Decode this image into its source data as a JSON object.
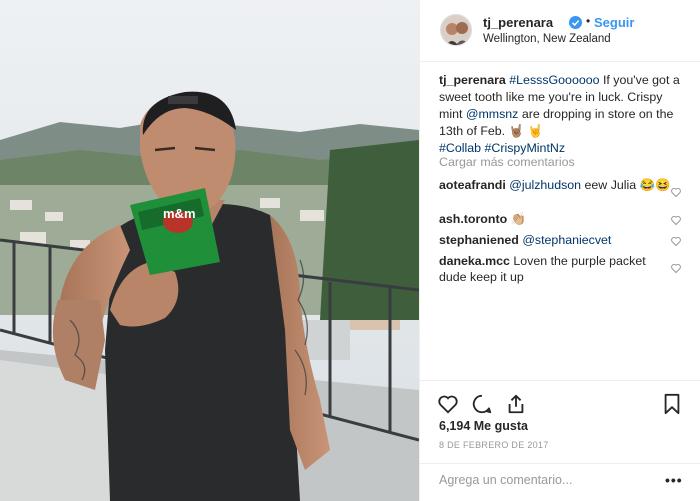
{
  "header": {
    "username": "tj_perenara",
    "separator": "•",
    "follow_label": "Seguir",
    "location": "Wellington, New Zealand"
  },
  "photo": {
    "bag_text": "m&m"
  },
  "caption": {
    "username": "tj_perenara",
    "hashtag_1": "#LesssGoooooo",
    "text_1": " If you've got a sweet tooth like me you're in luck. Crispy mint ",
    "mention": "@mmsnz",
    "text_2": " are dropping in store on the 13th of Feb. 🤘🏽 🤘",
    "hashtag_2": "#Collab",
    "hashtag_3": "#CrispyMintNz"
  },
  "load_more": "Cargar más comentarios",
  "comments": [
    {
      "username": "aoteafrandi",
      "mention": "@julzhudson",
      "text": " eew Julia 😂😆"
    },
    {
      "username": "ash.toronto",
      "mention": "",
      "text": " 👏🏼"
    },
    {
      "username": "stephaniened",
      "mention": "@stephaniecvet",
      "text": ""
    },
    {
      "username": "daneka.mcc",
      "mention": "",
      "text": " Loven the purple packet dude keep it up"
    }
  ],
  "likes": "6,194 Me gusta",
  "date": "8 DE FEBRERO DE 2017",
  "add_comment": {
    "placeholder": "Agrega un comentario...",
    "more_label": "•••"
  },
  "colors": {
    "accent": "#3897f0",
    "link": "#003569",
    "muted": "#999999",
    "text": "#262626",
    "bag_green": "#1f8f3a"
  },
  "icons": [
    "verified-badge-icon",
    "heart-icon",
    "comment-icon",
    "share-icon",
    "bookmark-icon",
    "more-options-icon"
  ]
}
